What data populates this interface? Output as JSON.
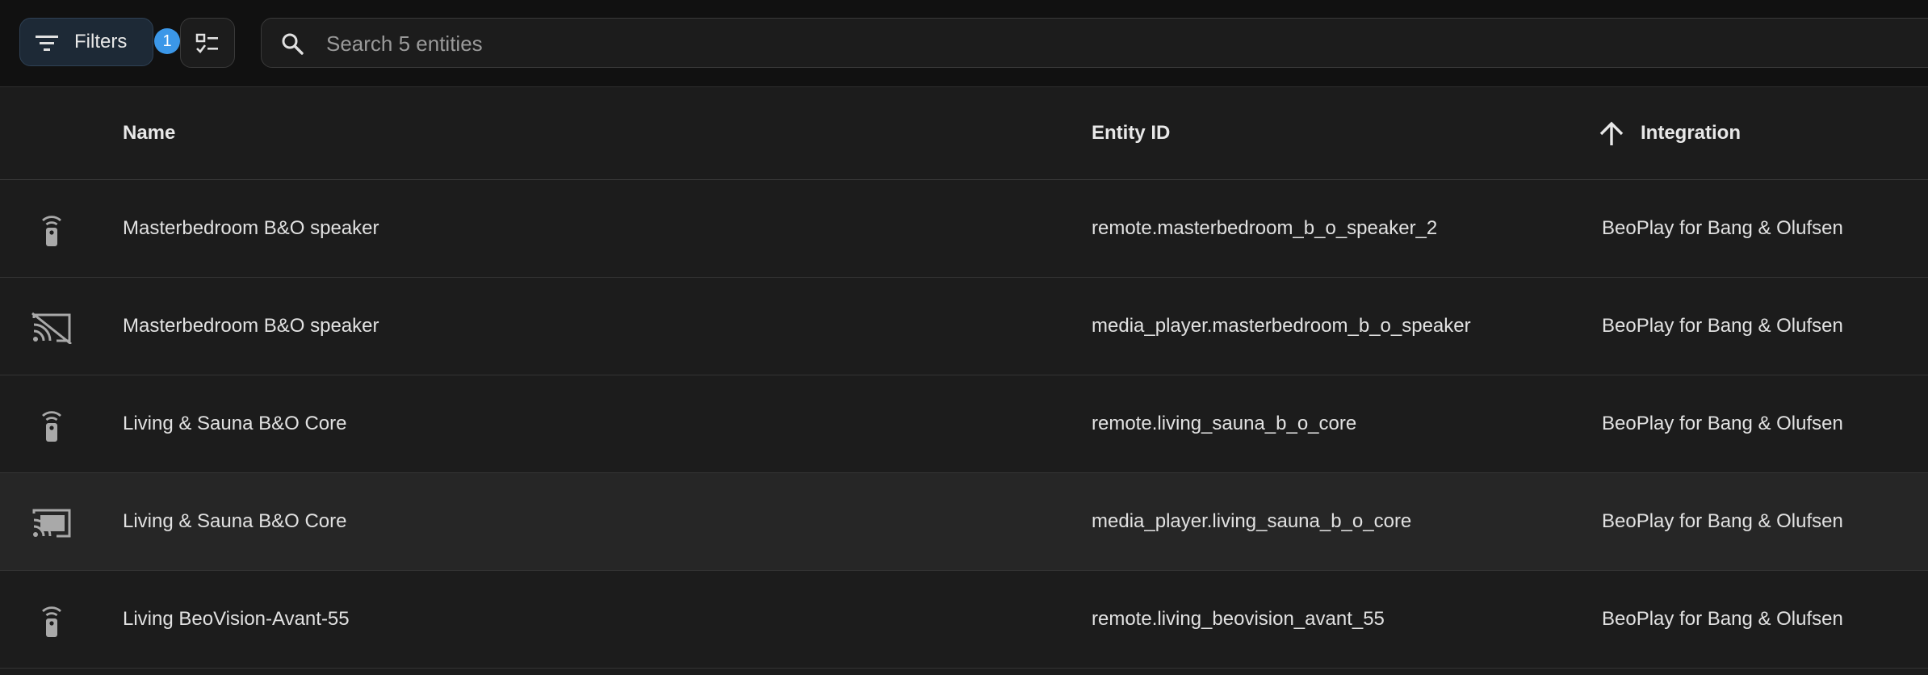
{
  "toolbar": {
    "filters_label": "Filters",
    "filters_badge": "1",
    "search_placeholder": "Search 5 entities"
  },
  "columns": {
    "name": "Name",
    "entity_id": "Entity ID",
    "integration": "Integration",
    "sorted_by": "integration",
    "sort_direction": "ascending"
  },
  "rows": [
    {
      "icon": "remote-icon",
      "name": "Masterbedroom B&O speaker",
      "entity_id": "remote.masterbedroom_b_o_speaker_2",
      "integration": "BeoPlay for Bang & Olufsen"
    },
    {
      "icon": "cast-off-icon",
      "name": "Masterbedroom B&O speaker",
      "entity_id": "media_player.masterbedroom_b_o_speaker",
      "integration": "BeoPlay for Bang & Olufsen"
    },
    {
      "icon": "remote-icon",
      "name": "Living & Sauna B&O Core",
      "entity_id": "remote.living_sauna_b_o_core",
      "integration": "BeoPlay for Bang & Olufsen"
    },
    {
      "icon": "cast-connected-icon",
      "name": "Living & Sauna B&O Core",
      "entity_id": "media_player.living_sauna_b_o_core",
      "integration": "BeoPlay for Bang & Olufsen"
    },
    {
      "icon": "remote-icon",
      "name": "Living BeoVision-Avant-55",
      "entity_id": "remote.living_beovision_avant_55",
      "integration": "BeoPlay for Bang & Olufsen"
    }
  ],
  "colors": {
    "background": "#1c1c1c",
    "toolbar": "#111111",
    "accent": "#3b97e8",
    "icon": "#a9a9a9"
  }
}
